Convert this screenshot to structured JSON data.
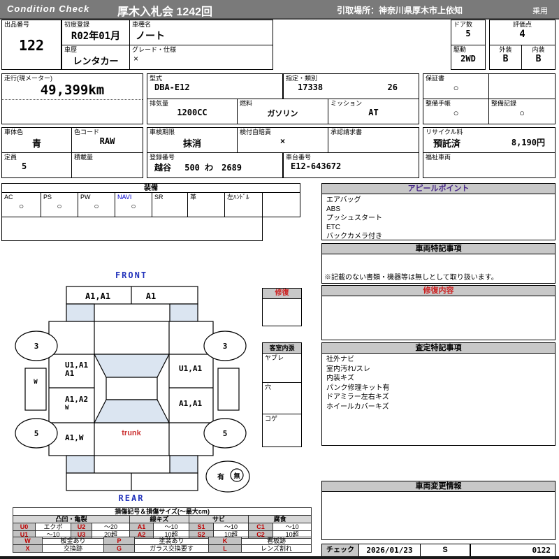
{
  "colors": {
    "header_bg": "#7a7a7a",
    "accent_blue": "#2233bb",
    "accent_red": "#cc2222",
    "appeal_title": "#4a2a8a",
    "navi_blue": "#0000cc",
    "glass_blue": "#dbe5f1",
    "gray_cell": "#c8c8c8"
  },
  "header": {
    "brand": "Condition  Check",
    "title": "厚木入札会  1242回",
    "pickup": "引取場所：神奈川県厚木市上依知",
    "usage": "乗用"
  },
  "info": {
    "lot_label": "出品番号",
    "lot_value": "122",
    "first_reg_label": "初度登録",
    "first_reg_value": "R02年01月",
    "history_label": "車歴",
    "history_value": "レンタカー",
    "model_label": "車種名",
    "model_value": "ノート",
    "grade_label": "グレード・仕様",
    "grade_value": "×",
    "doors_label": "ドア数",
    "doors_value": "5",
    "score_label": "評価点",
    "score_value": "4",
    "drive_label": "駆動",
    "drive_value": "2WD",
    "exterior_label": "外装",
    "exterior_value": "B",
    "interior_label": "内装",
    "interior_value": "B",
    "mileage_label": "走行(現メーター)",
    "mileage_value": "49,399km",
    "model_code_label": "型式",
    "model_code_value": "DBA-E12",
    "class_label": "指定・類別",
    "class_value1": "17338",
    "class_value2": "26",
    "warranty_label": "保証書",
    "warranty_value": "○",
    "displacement_label": "排気量",
    "displacement_value": "1200CC",
    "fuel_label": "燃料",
    "fuel_value": "ガソリン",
    "mission_label": "ミッション",
    "mission_value": "AT",
    "maint_book_label": "整備手帳",
    "maint_book_value": "○",
    "maint_rec_label": "整備記録",
    "maint_rec_value": "○",
    "body_color_label": "車体色",
    "body_color_value": "青",
    "color_code_label": "色コード",
    "color_code_value": "RAW",
    "inspection_label": "車検期限",
    "inspection_value": "抹消",
    "insurance_label": "検付自賠責",
    "insurance_value": "×",
    "approval_label": "承認請求書",
    "approval_value": "",
    "recycle_label": "リサイクル料",
    "recycle_status": "預託済",
    "recycle_fee": "8,190円",
    "capacity_label": "定員",
    "capacity_value": "5",
    "load_label": "積載量",
    "load_value": "",
    "plate_label": "登録番号",
    "plate_value": "越谷　 500 わ　2689",
    "vin_label": "車台番号",
    "vin_value": "E12-643672",
    "welfare_label": "福祉車両",
    "welfare_value": ""
  },
  "equipment": {
    "title": "装備",
    "items": [
      {
        "label": "AC",
        "value": "○"
      },
      {
        "label": "PS",
        "value": "○"
      },
      {
        "label": "PW",
        "value": "○"
      },
      {
        "label": "NAVI",
        "value": "○"
      },
      {
        "label": "SR",
        "value": ""
      },
      {
        "label": "革",
        "value": ""
      },
      {
        "label": "左ﾊﾝﾄﾞﾙ",
        "value": ""
      },
      {
        "label": "",
        "value": ""
      }
    ]
  },
  "diagram": {
    "front_label": "FRONT",
    "rear_label": "REAR",
    "trunk_label": "trunk",
    "front_bumper_left": "A1,A1",
    "front_bumper_right": "A1",
    "wheel_front_left": "3",
    "wheel_front_right": "3",
    "wheel_rear_left": "5",
    "wheel_rear_right": "5",
    "left_sill_mark": "W",
    "left_front_door_line1": "U1,A1",
    "left_front_door_line2": "A1",
    "left_rear_door_line1": "A1,A2",
    "left_rear_door_line2": "W",
    "left_quarter": "A1,W",
    "right_front_door": "U1,A1",
    "right_rear_door": "A1,A1",
    "repair_box_title": "修復",
    "cabin_box_title": "客室内張",
    "cabin_items": [
      "ヤブレ",
      "穴",
      "コゲ"
    ],
    "spare_yes": "有",
    "spare_no": "無"
  },
  "panels": {
    "appeal": {
      "title": "アピールポイント",
      "items": [
        "エアバッグ",
        "ABS",
        "プッシュスタート",
        "ETC",
        "バックカメラ付き"
      ]
    },
    "notes": {
      "title": "車両特記事項",
      "note": "※記載のない書類・機器等は無しとして取り扱います。"
    },
    "repair": {
      "title": "修復内容",
      "content": ""
    },
    "assessment": {
      "title": "査定特記事項",
      "items": [
        "社外ナビ",
        "室内汚れ/スレ",
        "内装キズ",
        "パンク修理キット有",
        "ドアミラー左右キズ",
        "ホイールカバーキズ"
      ]
    },
    "changes": {
      "title": "車両変更情報",
      "content": ""
    },
    "check": {
      "label": "チェック",
      "date": "2026/01/23",
      "inspector": "S",
      "number": "0122"
    }
  },
  "legend": {
    "title": "損傷記号＆損傷サイズ(〜最大cm)",
    "groups": [
      "凸凹・亀裂",
      "線キズ",
      "サビ",
      "腐食"
    ],
    "rows": [
      [
        "U0",
        "エクボ",
        "U2",
        "〜20",
        "A1",
        "〜10",
        "S1",
        "〜10",
        "C1",
        "〜10"
      ],
      [
        "U1",
        "〜10",
        "U3",
        "20超",
        "A2",
        "10超",
        "S2",
        "10超",
        "C2",
        "10超"
      ]
    ],
    "rows2": [
      [
        "W",
        "板金あり",
        "P",
        "塗装あり",
        "K",
        "看板跡"
      ],
      [
        "X",
        "交換跡",
        "G",
        "ガラス交換要す",
        "L",
        "レンズ割れ"
      ]
    ]
  }
}
